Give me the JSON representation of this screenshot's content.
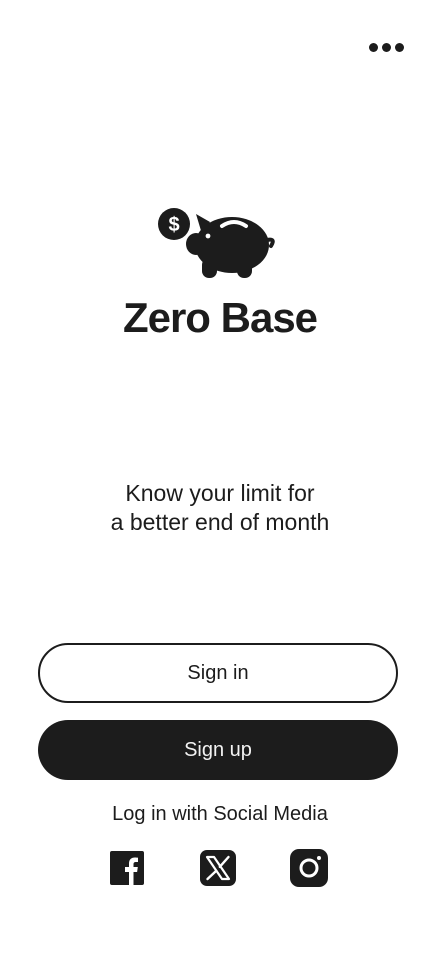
{
  "app": {
    "title": "Zero Base",
    "tagline_line1": "Know your limit for",
    "tagline_line2": "a better end of month",
    "logo_icon": "piggy-bank-coin-icon"
  },
  "header": {
    "more_icon": "more-horizontal-icon"
  },
  "actions": {
    "sign_in_label": "Sign in",
    "sign_up_label": "Sign up"
  },
  "social": {
    "label": "Log in with Social Media",
    "providers": [
      {
        "name": "Facebook",
        "icon": "facebook-icon"
      },
      {
        "name": "X",
        "icon": "x-icon"
      },
      {
        "name": "Instagram",
        "icon": "instagram-icon"
      }
    ]
  },
  "colors": {
    "primary": "#1c1c1c",
    "background": "#ffffff",
    "on_primary": "#f2f2f2"
  }
}
